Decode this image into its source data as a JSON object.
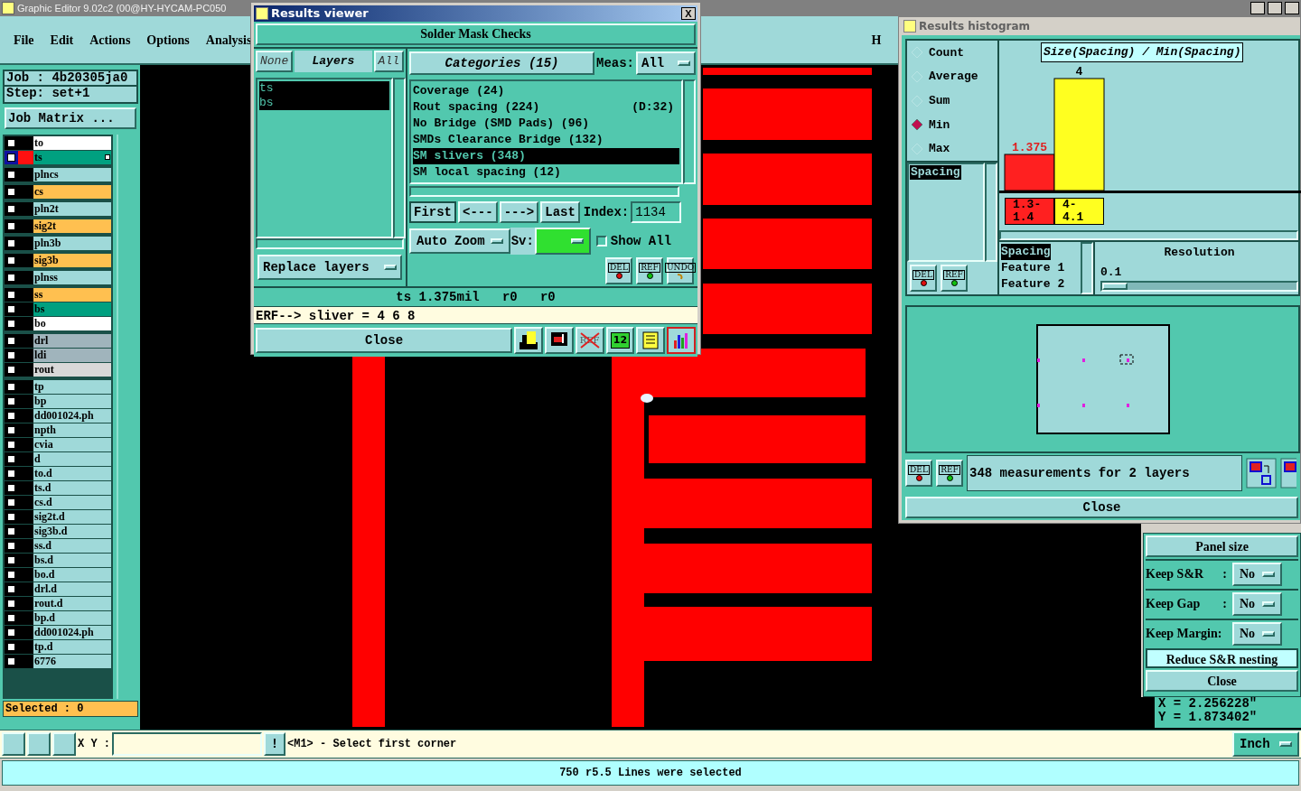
{
  "main_window": {
    "title": "Graphic Editor 9.02c2 (00@HY-HYCAM-PC050",
    "menu": [
      "File",
      "Edit",
      "Actions",
      "Options",
      "Analysis"
    ],
    "menu_cut": "H"
  },
  "job_panel": {
    "job": "Job : 4b20305ja0",
    "step": "Step: set+1",
    "matrix_button": "Job Matrix ...",
    "selected_count": "Selected : 0",
    "layer_groups": [
      [
        {
          "name": "to",
          "color": "#ffffff",
          "selected": false,
          "checked": false
        },
        {
          "name": "ts",
          "color": "#00a080",
          "selected": true,
          "checked": false
        }
      ],
      [
        {
          "name": "plncs",
          "color": "#9fd9d9",
          "selected": false,
          "checked": false
        }
      ],
      [
        {
          "name": "cs",
          "color": "#ffc050",
          "selected": false,
          "checked": false
        }
      ],
      [
        {
          "name": "pln2t",
          "color": "#9fd9d9",
          "selected": false,
          "checked": false
        }
      ],
      [
        {
          "name": "sig2t",
          "color": "#ffc050",
          "selected": false,
          "checked": false
        }
      ],
      [
        {
          "name": "pln3b",
          "color": "#9fd9d9",
          "selected": false,
          "checked": false
        }
      ],
      [
        {
          "name": "sig3b",
          "color": "#ffc050",
          "selected": false,
          "checked": false
        }
      ],
      [
        {
          "name": "plnss",
          "color": "#9fd9d9",
          "selected": false,
          "checked": false
        }
      ],
      [
        {
          "name": "ss",
          "color": "#ffc050",
          "selected": false,
          "checked": false
        },
        {
          "name": "bs",
          "color": "#00a080",
          "selected": false,
          "checked": false
        },
        {
          "name": "bo",
          "color": "#ffffff",
          "selected": false,
          "checked": false
        }
      ],
      [
        {
          "name": "drl",
          "color": "#a0b4bc",
          "selected": false,
          "checked": false
        },
        {
          "name": "ldi",
          "color": "#a0b4bc",
          "selected": false,
          "checked": false
        },
        {
          "name": "rout",
          "color": "#d8d8d8",
          "selected": false,
          "checked": false
        }
      ],
      [
        {
          "name": "tp",
          "color": "#9fd9d9",
          "selected": false,
          "checked": false
        },
        {
          "name": "bp",
          "color": "#9fd9d9",
          "selected": false,
          "checked": false
        },
        {
          "name": "dd001024.ph",
          "color": "#9fd9d9",
          "selected": false,
          "checked": false
        },
        {
          "name": "npth",
          "color": "#9fd9d9",
          "selected": false,
          "checked": false
        },
        {
          "name": "cvia",
          "color": "#9fd9d9",
          "selected": false,
          "checked": false
        },
        {
          "name": "d",
          "color": "#9fd9d9",
          "selected": false,
          "checked": false
        },
        {
          "name": "to.d",
          "color": "#9fd9d9",
          "selected": false,
          "checked": false
        },
        {
          "name": "ts.d",
          "color": "#9fd9d9",
          "selected": false,
          "checked": false
        },
        {
          "name": "cs.d",
          "color": "#9fd9d9",
          "selected": false,
          "checked": false
        },
        {
          "name": "sig2t.d",
          "color": "#9fd9d9",
          "selected": false,
          "checked": false
        },
        {
          "name": "sig3b.d",
          "color": "#9fd9d9",
          "selected": false,
          "checked": false
        },
        {
          "name": "ss.d",
          "color": "#9fd9d9",
          "selected": false,
          "checked": false
        },
        {
          "name": "bs.d",
          "color": "#9fd9d9",
          "selected": false,
          "checked": false
        },
        {
          "name": "bo.d",
          "color": "#9fd9d9",
          "selected": false,
          "checked": false
        },
        {
          "name": "drl.d",
          "color": "#9fd9d9",
          "selected": false,
          "checked": false
        },
        {
          "name": "rout.d",
          "color": "#9fd9d9",
          "selected": false,
          "checked": false
        },
        {
          "name": "bp.d",
          "color": "#9fd9d9",
          "selected": false,
          "checked": false
        },
        {
          "name": "dd001024.ph",
          "color": "#9fd9d9",
          "selected": false,
          "checked": false
        },
        {
          "name": "tp.d",
          "color": "#9fd9d9",
          "selected": false,
          "checked": false
        },
        {
          "name": "6776",
          "color": "#9fd9d9",
          "selected": false,
          "checked": false
        }
      ]
    ]
  },
  "results_viewer": {
    "title": "Results viewer",
    "close_glyph": "X",
    "heading": "Solder Mask Checks",
    "layer_buttons": [
      {
        "label": "None",
        "selected": false
      },
      {
        "label": "Layers",
        "selected": true
      },
      {
        "label": "All",
        "selected": false
      }
    ],
    "layers": [
      {
        "name": "ts",
        "selected": true
      },
      {
        "name": "bs",
        "selected": true
      }
    ],
    "categories_button": "Categories (15)",
    "meas_label": "Meas:",
    "meas_value": "All",
    "categories": [
      {
        "name": "Coverage (24)",
        "selected": false
      },
      {
        "name": "Rout spacing (224)",
        "extra": "(D:32)",
        "selected": false
      },
      {
        "name": "No Bridge (SMD Pads) (96)",
        "selected": false
      },
      {
        "name": "SMDs Clearance Bridge (132)",
        "selected": false
      },
      {
        "name": "SM slivers (348)",
        "selected": true
      },
      {
        "name": "SM local spacing (12)",
        "selected": false
      }
    ],
    "nav": [
      {
        "label": "First",
        "selected": true
      },
      {
        "label": "<---",
        "selected": false
      },
      {
        "label": "--->",
        "selected": false
      },
      {
        "label": "Last",
        "selected": false
      }
    ],
    "index_label": "Index:",
    "index_value": "1134",
    "auto_zoom": "Auto Zoom",
    "sv_label": "Sv:",
    "show_all": {
      "label": "Show All",
      "checked": false
    },
    "replace_layers": "Replace layers",
    "action_buttons": [
      {
        "label": "DEL",
        "kind": "del"
      },
      {
        "label": "REF",
        "kind": "ref"
      },
      {
        "label": "UNDO",
        "kind": "undo"
      }
    ],
    "measure": "ts 1.375mil   r0   r0",
    "erf": "ERF--> sliver = 4 6 8",
    "close": "Close",
    "tools": [
      {
        "kind": "figure",
        "selected": false
      },
      {
        "kind": "screen",
        "selected": false
      },
      {
        "kind": "crossed",
        "label": "REF",
        "selected": false
      },
      {
        "kind": "numbered",
        "label": "12",
        "selected": false
      },
      {
        "kind": "notes",
        "selected": false
      },
      {
        "kind": "histogram",
        "selected": true
      }
    ]
  },
  "histogram": {
    "title": "Results histogram",
    "modes": [
      {
        "label": "Count",
        "selected": false
      },
      {
        "label": "Average",
        "selected": false
      },
      {
        "label": "Sum",
        "selected": false
      },
      {
        "label": "Min",
        "selected": true
      },
      {
        "label": "Max",
        "selected": false
      }
    ],
    "attributes": [
      {
        "name": "Spacing",
        "selected": true
      }
    ],
    "list_buttons": [
      {
        "label": "DEL",
        "kind": "del"
      },
      {
        "label": "REF",
        "kind": "ref"
      }
    ],
    "chart_title": "Size(Spacing) / Min(Spacing)",
    "bins": [
      {
        "value_label": "1.375",
        "range": "1.3- 1.4",
        "color": "#ff2020",
        "minimum": true
      },
      {
        "value_label": "4",
        "range": "4- 4.1",
        "color": "#ffff20",
        "minimum": false
      }
    ],
    "fields": [
      {
        "name": "Spacing",
        "selected": true
      },
      {
        "name": "Feature 1",
        "selected": false
      },
      {
        "name": "Feature 2",
        "selected": false
      }
    ],
    "resolution_label": "Resolution",
    "resolution_value": "0.1",
    "bottom_buttons": [
      {
        "label": "DEL",
        "kind": "del"
      },
      {
        "label": "REF",
        "kind": "ref"
      }
    ],
    "message": "348 measurements for 2 layers",
    "close": "Close"
  },
  "panel_dialog": {
    "panel_size": "Panel size",
    "options": [
      {
        "label": "Keep S&R",
        "sep": ":",
        "value": "No"
      },
      {
        "label": "Keep Gap",
        "sep": ":",
        "value": "No"
      },
      {
        "label": "Keep Margin:",
        "value": "No"
      }
    ],
    "reduce": {
      "label": "Reduce S&R nesting",
      "on": true
    },
    "close": "Close"
  },
  "coordinates": {
    "x": "X = 2.256228\"",
    "y": "Y = 1.873402\""
  },
  "command_bar": {
    "xy_label": "X Y :",
    "bang": "!",
    "prompt": "<M1> - Select first corner",
    "units": "Inch"
  },
  "status_bar": "750 r5.5 Lines were selected"
}
